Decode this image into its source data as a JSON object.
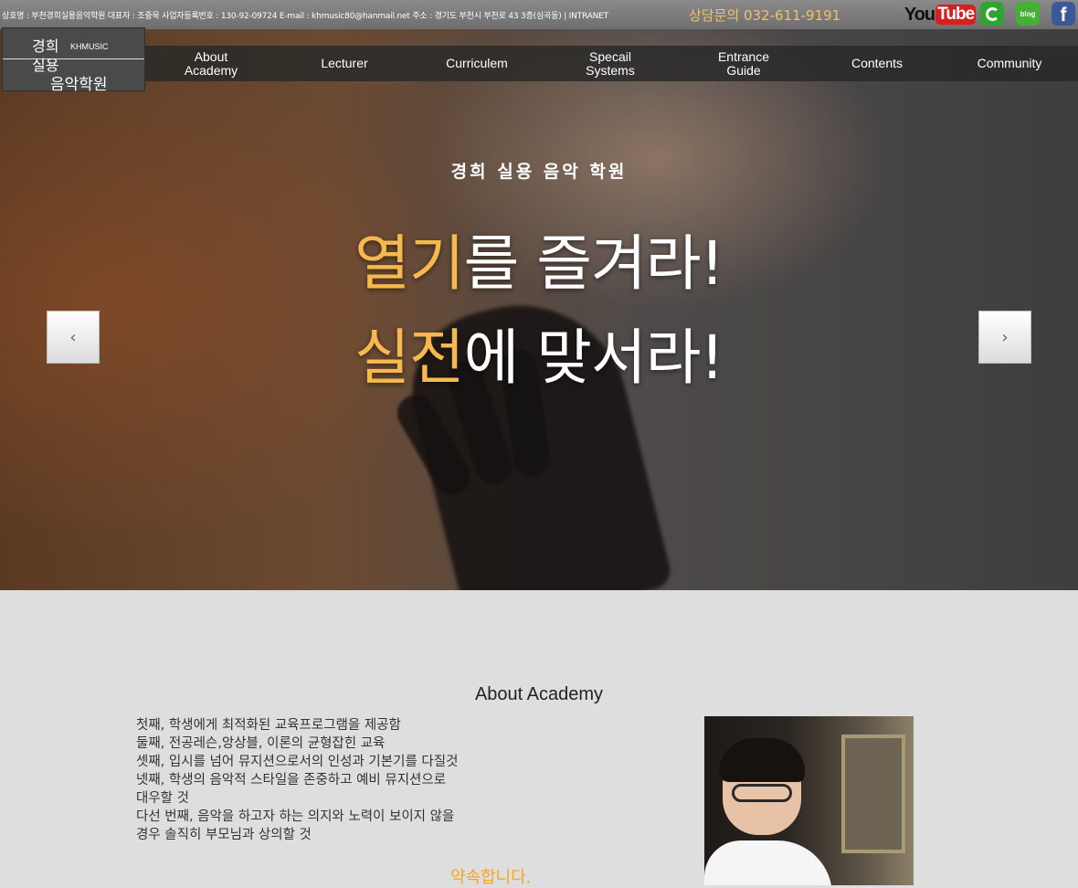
{
  "topbar": {
    "info": "상호명 : 부천경희실용음악학원 대표자 : 조중묵 사업자등록번호 : 130-92-09724 E-mail : khmusic80@hanmail.net 주소 : 경기도 부천시 부천로 43 3층(심곡동)  |  INTRANET",
    "phone": "상담문의 032-611-9191",
    "youtube_you": "You",
    "youtube_tube": "Tube",
    "blog": "blog",
    "facebook": "f"
  },
  "logo": {
    "line1": "경희",
    "line2": "실용",
    "line3": "음악학원",
    "english": "KHMUSIC"
  },
  "nav": {
    "items": [
      {
        "label": "About\nAcademy"
      },
      {
        "label": "Lecturer"
      },
      {
        "label": "Curriculem"
      },
      {
        "label": "Specail\nSystems"
      },
      {
        "label": "Entrance\nGuide"
      },
      {
        "label": "Contents"
      },
      {
        "label": "Community"
      }
    ]
  },
  "hero": {
    "subtitle": "경희 실용 음악 학원",
    "line1_highlight": "열기",
    "line1_rest": "를 즐겨라!",
    "line2_highlight": "실전",
    "line2_rest": "에 맞서라!",
    "prev": "‹",
    "next": "›"
  },
  "about": {
    "title": "About Academy",
    "lines": [
      "첫째, 학생에게 최적화된 교육프로그램을 제공함",
      "둘째, 전공레슨,앙상블, 이론의 균형잡힌 교육",
      "셋째, 입시를 넘어 뮤지션으로서의 인성과 기본기를 다질것",
      "넷째, 학생의 음악적 스타일을 존중하고 예비 뮤지션으로",
      "대우할 것",
      "다선 번째, 음악을 하고자 하는 의지와 노력이 보이지 않을",
      "경우 솔직히 부모님과 상의할 것"
    ],
    "signature": "약속합니다."
  },
  "colors": {
    "accent": "#f7b94d",
    "topbar": "#7a7a7a",
    "nav": "#282828",
    "section_bg": "#dedede"
  }
}
